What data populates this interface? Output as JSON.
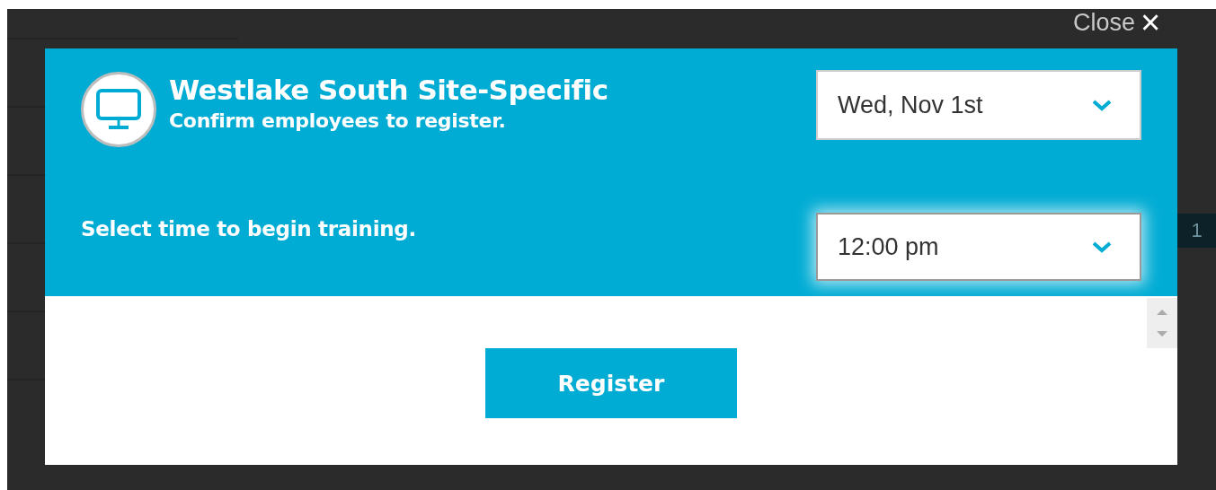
{
  "close_link": {
    "label": "Close",
    "icon": "×"
  },
  "background_badge": "1",
  "modal": {
    "title": "Westlake South Site-Specific",
    "subtitle": "Confirm employees to register.",
    "time_prompt": "Select time to begin training.",
    "selects": [
      {
        "value": "Wed, Nov 1st",
        "focused": false
      },
      {
        "value": "12:00 pm",
        "focused": true
      }
    ],
    "button": "Register"
  }
}
